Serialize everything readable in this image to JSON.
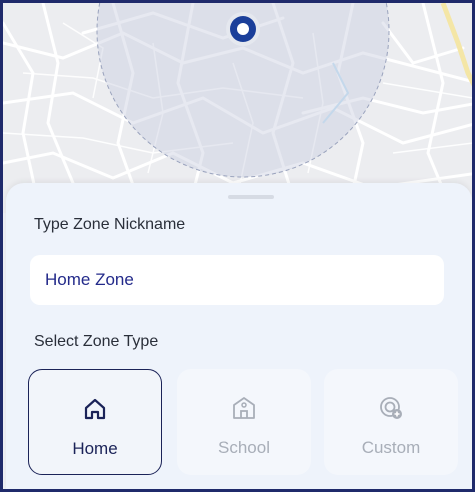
{
  "map": {
    "pin": "location-pin",
    "colors": {
      "land": "#ecedf0",
      "road": "#ffffff",
      "radius": "#c9cfe0",
      "pin": "#1b3f9a",
      "highway": "#f4e6a6"
    }
  },
  "form": {
    "nickname_label": "Type Zone Nickname",
    "nickname_value": "Home Zone",
    "zone_type_label": "Select Zone Type"
  },
  "zone_types": [
    {
      "label": "Home",
      "icon": "home-icon",
      "selected": true
    },
    {
      "label": "School",
      "icon": "school-icon",
      "selected": false
    },
    {
      "label": "Custom",
      "icon": "custom-location-icon",
      "selected": false
    }
  ],
  "colors": {
    "accent": "#1b2358",
    "sheet": "#eef3fb",
    "muted_text": "#a8aeb8"
  }
}
